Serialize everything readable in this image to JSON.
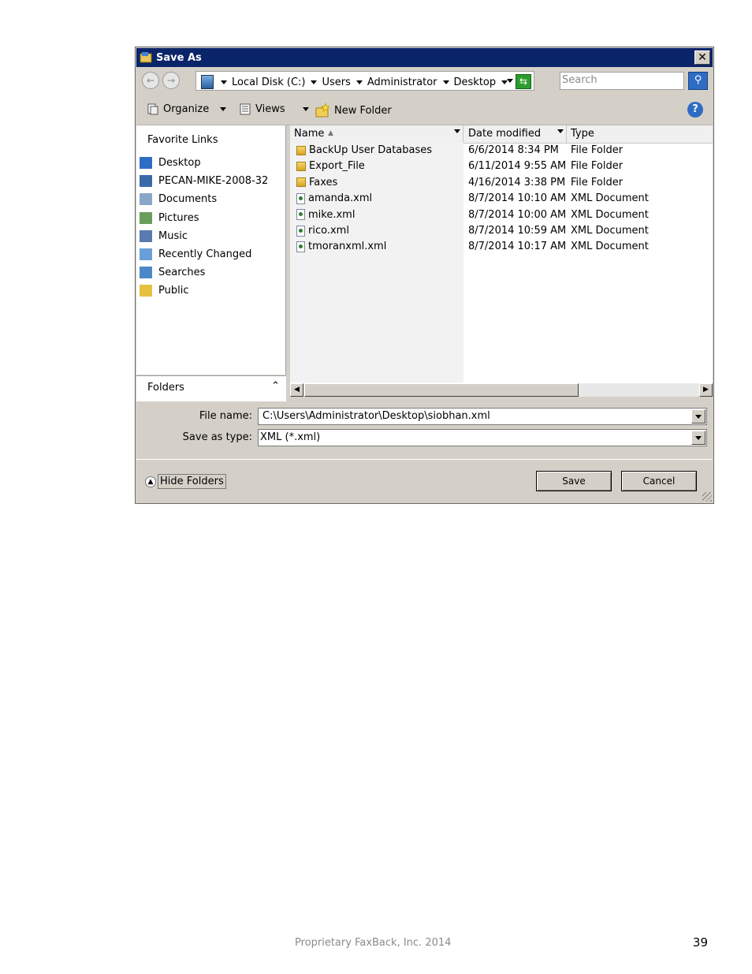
{
  "window": {
    "title": "Save As"
  },
  "address": {
    "crumbs": [
      "Local Disk (C:)",
      "Users",
      "Administrator",
      "Desktop"
    ],
    "search_placeholder": "Search"
  },
  "toolbar": {
    "organize": "Organize",
    "views": "Views",
    "new_folder": "New Folder"
  },
  "sidebar": {
    "heading": "Favorite Links",
    "items": [
      {
        "label": "Desktop",
        "icon": "desktop-icon"
      },
      {
        "label": "PECAN-MIKE-2008-32",
        "icon": "computer-icon"
      },
      {
        "label": "Documents",
        "icon": "documents-icon"
      },
      {
        "label": "Pictures",
        "icon": "pictures-icon"
      },
      {
        "label": "Music",
        "icon": "music-icon"
      },
      {
        "label": "Recently Changed",
        "icon": "recent-icon"
      },
      {
        "label": "Searches",
        "icon": "searches-icon"
      },
      {
        "label": "Public",
        "icon": "folder-icon"
      }
    ],
    "folders_label": "Folders"
  },
  "file_list": {
    "columns": [
      "Name",
      "Date modified",
      "Type"
    ],
    "rows": [
      {
        "name": "BackUp User Databases",
        "date": "6/6/2014 8:34 PM",
        "type": "File Folder",
        "icon": "folder-icon"
      },
      {
        "name": "Export_File",
        "date": "6/11/2014 9:55 AM",
        "type": "File Folder",
        "icon": "folder-icon"
      },
      {
        "name": "Faxes",
        "date": "4/16/2014 3:38 PM",
        "type": "File Folder",
        "icon": "folder-icon"
      },
      {
        "name": "amanda.xml",
        "date": "8/7/2014 10:10 AM",
        "type": "XML Document",
        "icon": "xml-file-icon"
      },
      {
        "name": "mike.xml",
        "date": "8/7/2014 10:00 AM",
        "type": "XML Document",
        "icon": "xml-file-icon"
      },
      {
        "name": "rico.xml",
        "date": "8/7/2014 10:59 AM",
        "type": "XML Document",
        "icon": "xml-file-icon"
      },
      {
        "name": "tmoranxml.xml",
        "date": "8/7/2014 10:17 AM",
        "type": "XML Document",
        "icon": "xml-file-icon"
      }
    ]
  },
  "form": {
    "file_name_label": "File name:",
    "file_name_value": "C:\\Users\\Administrator\\Desktop\\siobhan.xml",
    "save_type_label": "Save as type:",
    "save_type_value": "XML (*.xml)"
  },
  "buttons": {
    "hide_folders": "Hide Folders",
    "save": "Save",
    "cancel": "Cancel"
  },
  "page": {
    "footer": "Proprietary FaxBack, Inc. 2014",
    "number": "39"
  }
}
